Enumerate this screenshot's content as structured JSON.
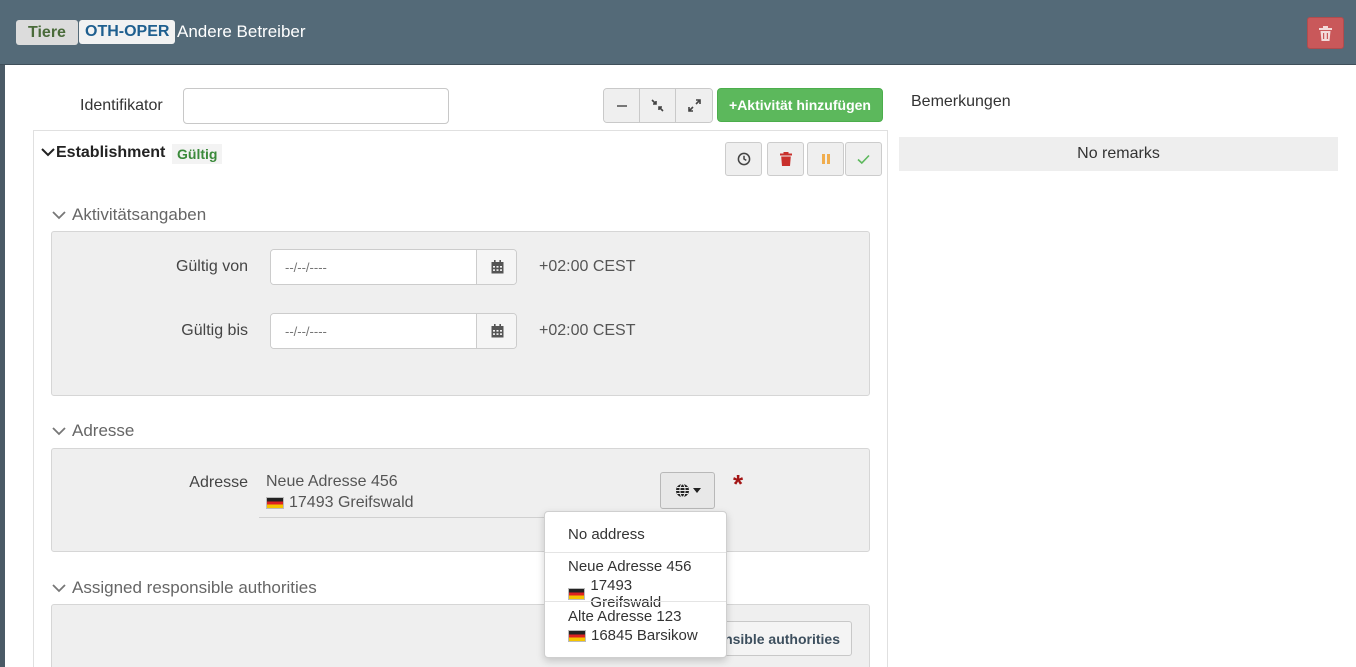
{
  "header": {
    "tag": "Tiere",
    "code": "OTH-OPER",
    "title": "Andere Betreiber"
  },
  "identifier": {
    "label": "Identifikator",
    "value": ""
  },
  "toolbar": {
    "add_activity_label": "+Aktivität hinzufügen"
  },
  "remarks": {
    "label": "Bemerkungen",
    "empty_text": "No remarks"
  },
  "establishment": {
    "title": "Establishment",
    "status": "Gültig"
  },
  "activity_section": {
    "title": "Aktivitätsangaben",
    "valid_from_label": "Gültig von",
    "valid_from_placeholder": "--/--/----",
    "valid_to_label": "Gültig bis",
    "valid_to_placeholder": "--/--/----",
    "timezone": "+02:00 CEST"
  },
  "address_section": {
    "title": "Adresse",
    "field_label": "Adresse",
    "street": "Neue Adresse 456",
    "city": "17493 Greifswald",
    "required_mark": "*"
  },
  "address_dropdown": {
    "options": [
      {
        "label": "No address"
      },
      {
        "street": "Neue Adresse 456",
        "city": "17493 Greifswald"
      },
      {
        "street": "Alte Adresse 123",
        "city": "16845 Barsikow"
      }
    ]
  },
  "authorities_section": {
    "title": "Assigned responsible authorities",
    "button_label": "Assign responsible authorities"
  },
  "colors": {
    "header_bg": "#546a78",
    "success": "#5cb85c",
    "danger": "#c9302c",
    "warning": "#f0ad4e",
    "status_green": "#3a8a3a",
    "required": "#a31515"
  }
}
